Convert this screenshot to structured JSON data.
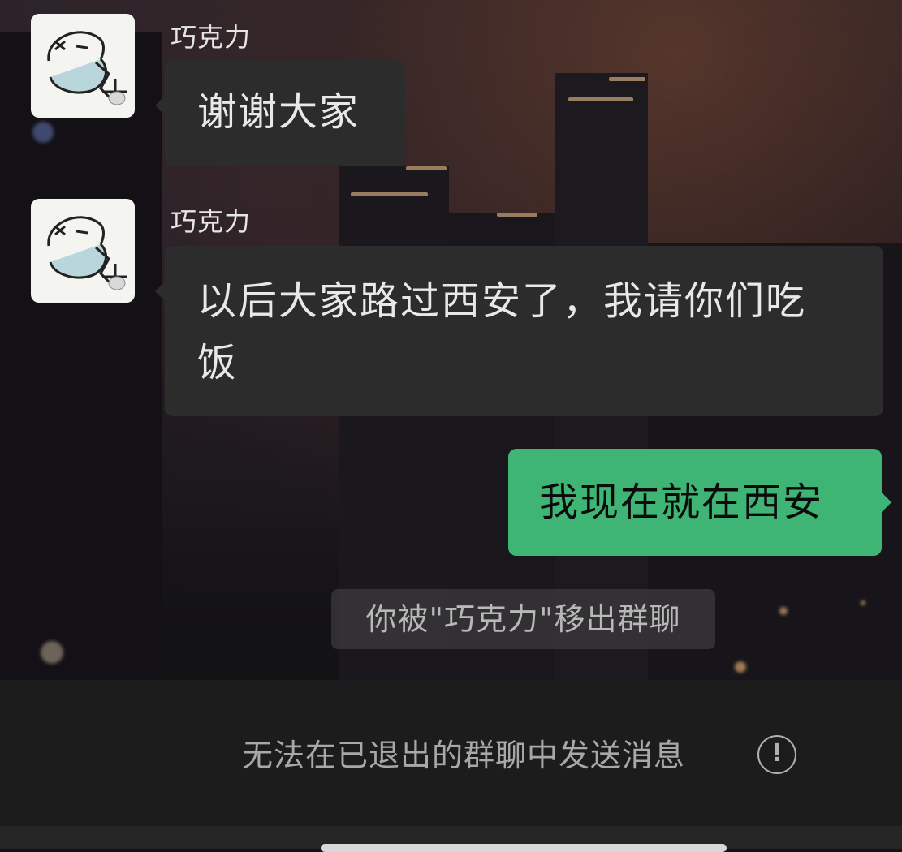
{
  "messages": [
    {
      "sender": "巧克力",
      "direction": "incoming",
      "text_lines": [
        "谢谢大家"
      ],
      "avatar_icon": "doodle-face-icon"
    },
    {
      "sender": "巧克力",
      "direction": "incoming",
      "text_lines": [
        "以后大家路过西安了，我请你们吃",
        "饭"
      ],
      "avatar_icon": "doodle-face-icon"
    },
    {
      "direction": "outgoing",
      "text_lines": [
        "我现在就在西安"
      ]
    }
  ],
  "system_notice": "你被\"巧克力\"移出群聊",
  "input_area": {
    "status_text": "无法在已退出的群聊中发送消息",
    "status_icon": "exclamation-circle-icon",
    "status_icon_glyph": "!"
  },
  "colors": {
    "outgoing_bubble": "#3eb574",
    "incoming_bubble": "#2c2c2c",
    "bottom_bar": "#1c1c1c"
  }
}
